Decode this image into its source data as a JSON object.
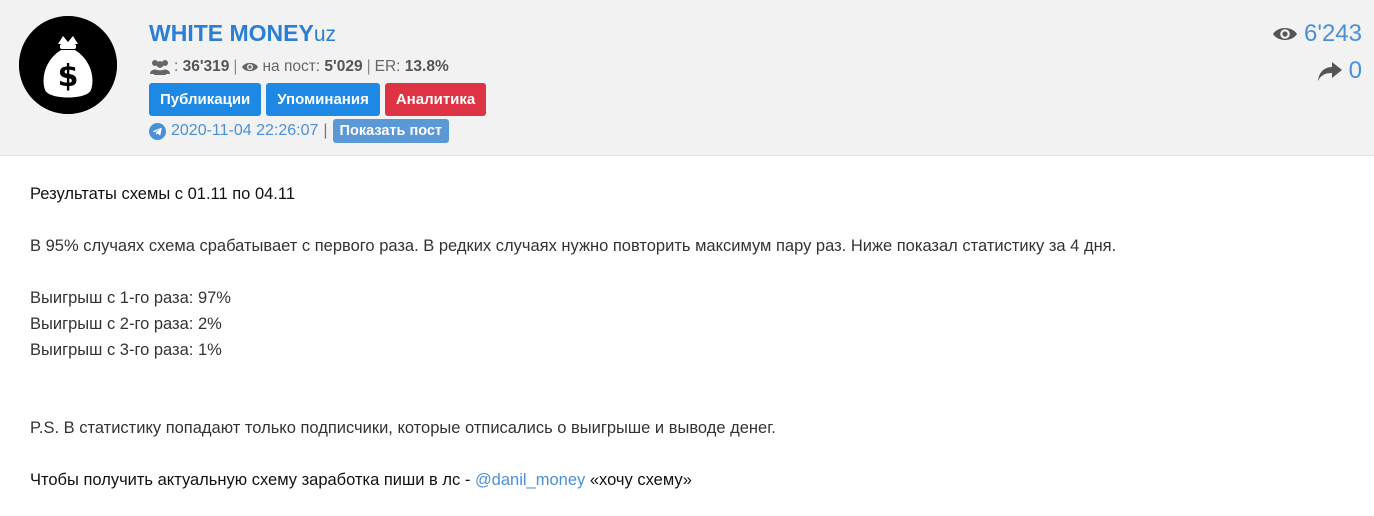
{
  "channel": {
    "name": "WHITE MONEY",
    "suffix": "uz"
  },
  "stats": {
    "subscribers": "36'319",
    "per_post_label": "на пост:",
    "per_post_value": "5'029",
    "er_label": "ER:",
    "er_value": "13.8%",
    "separator": "|"
  },
  "buttons": {
    "publications": "Публикации",
    "mentions": "Упоминания",
    "analytics": "Аналитика"
  },
  "post_meta": {
    "datetime": "2020-11-04 22:26:07",
    "separator": "|",
    "show_post": "Показать пост"
  },
  "counters": {
    "views": "6'243",
    "shares": "0"
  },
  "post": {
    "title": "Результаты схемы с 01.11 по 04.11",
    "intro": "В 95% случаях схема срабатывает с первого раза. В редких случаях нужно повторить максимум пару раз. Ниже показал статистику за 4 дня.",
    "wins": [
      "Выигрыш с 1-го раза: 97%",
      "Выигрыш с 2-го раза: 2%",
      "Выигрыш с 3-го раза: 1%"
    ],
    "ps": "P.S. В статистику попадают только подписчики, которые отписались о выигрыше и выводе денег.",
    "cta_text": "Чтобы получить актуальную схему заработка пиши в лс -",
    "cta_link": "@danil_money",
    "cta_suffix": "«хочу схему»"
  },
  "colors": {
    "accent": "#1e88e5",
    "danger": "#dd3344",
    "link": "#4a8fd8",
    "header_bg": "#f2f2f2"
  },
  "icons": {
    "avatar": "money-bag-dollar-icon",
    "subscribers": "users-icon",
    "views": "eye-icon",
    "shares": "share-arrow-icon",
    "telegram": "telegram-icon"
  }
}
